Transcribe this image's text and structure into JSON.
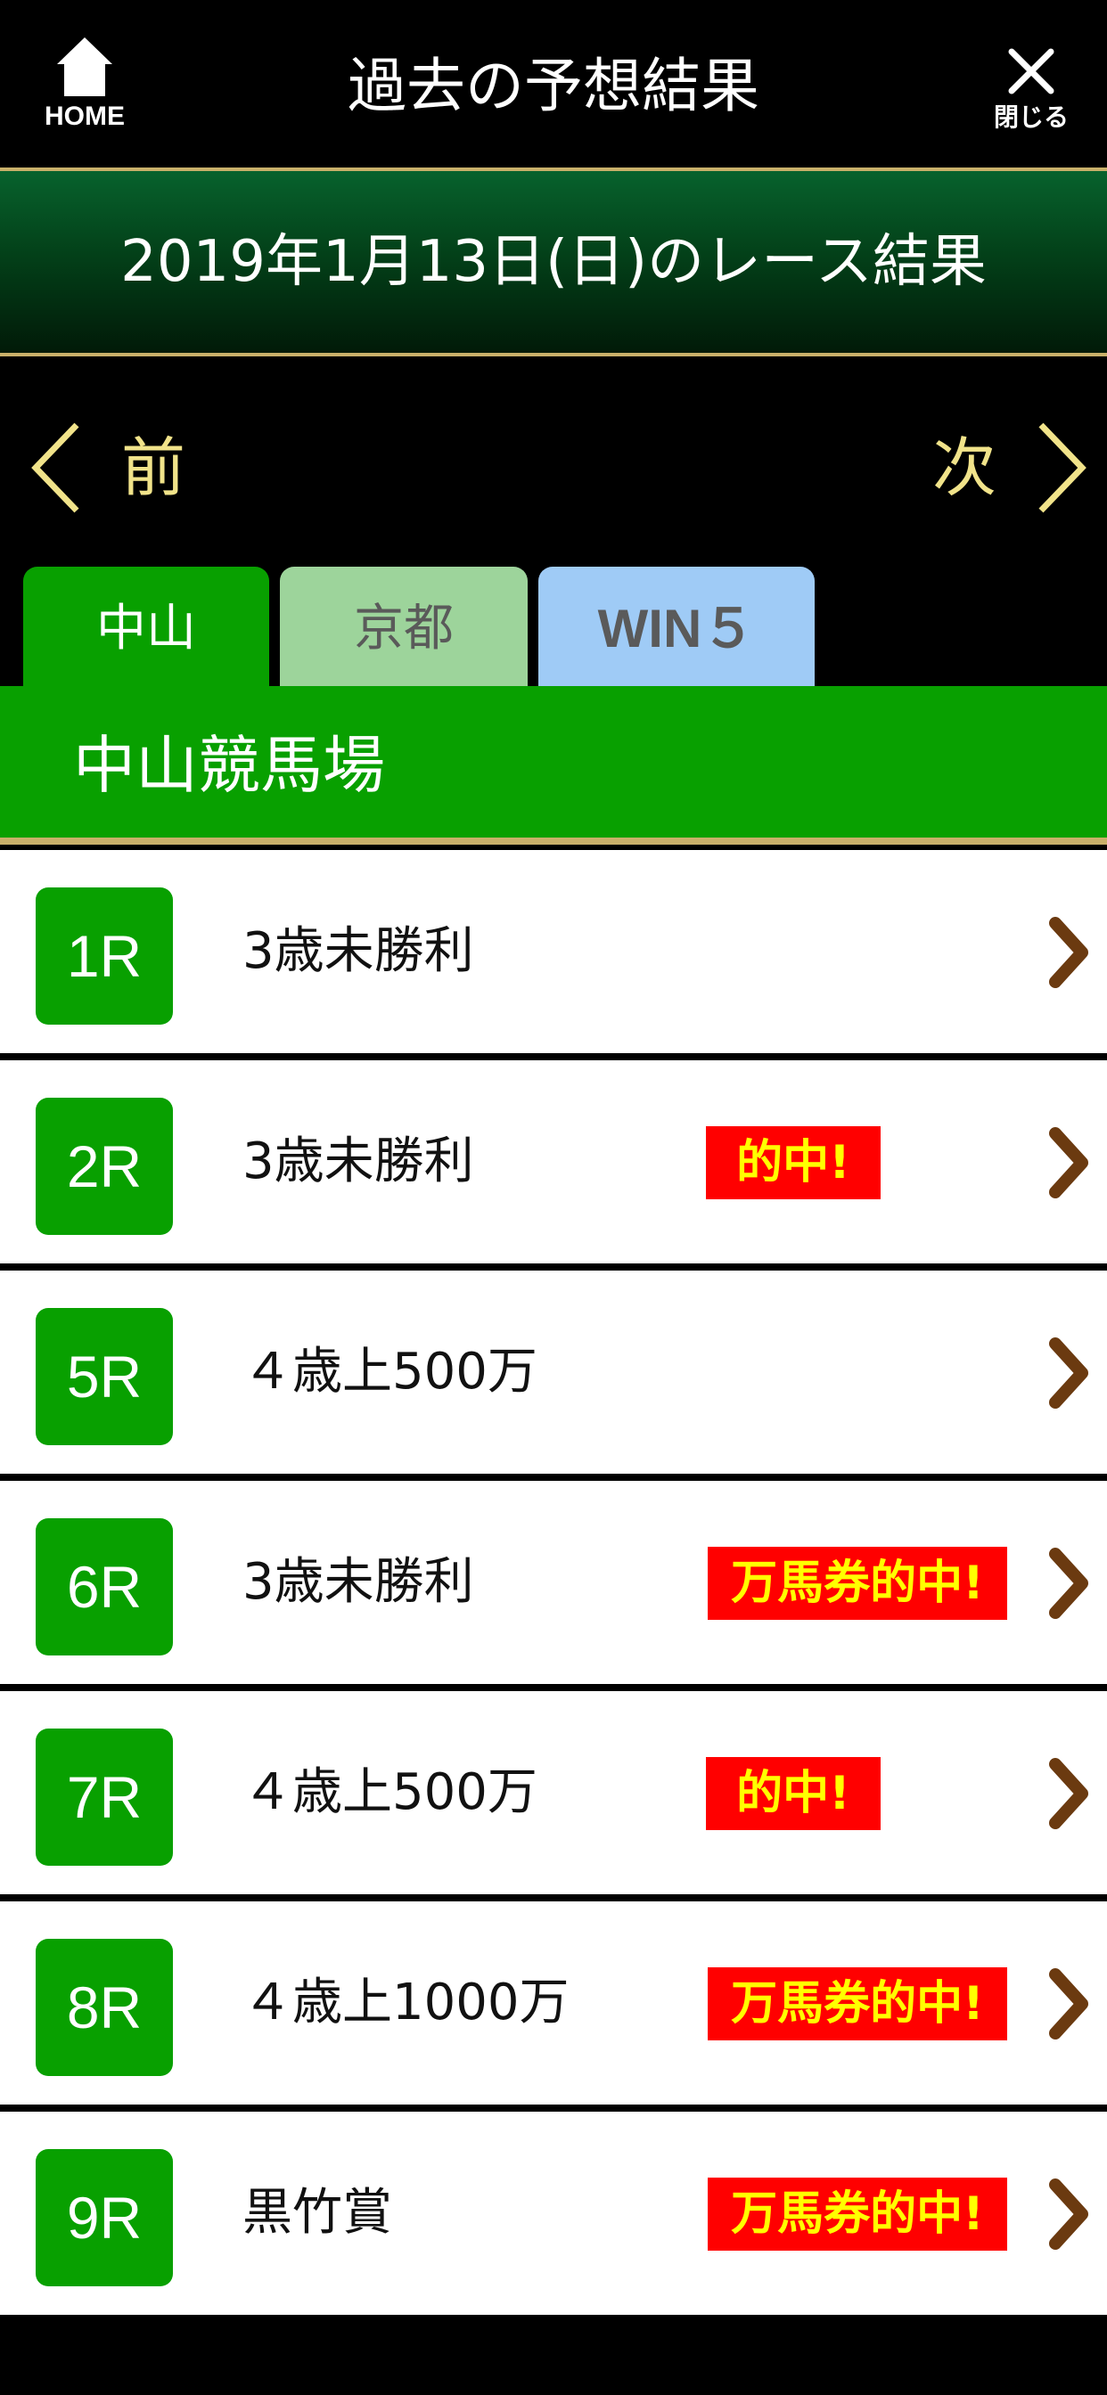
{
  "header": {
    "home_label": "HOME",
    "title": "過去の予想結果",
    "close_label": "閉じる"
  },
  "date_banner": {
    "text": "2019年1月13日(日)のレース結果"
  },
  "nav": {
    "prev_label": "前",
    "next_label": "次"
  },
  "tabs": [
    {
      "label": "中山",
      "active": true
    },
    {
      "label": "京都",
      "active": false
    },
    {
      "label": "WIN５",
      "active": false
    }
  ],
  "venue": {
    "name": "中山競馬場"
  },
  "races": [
    {
      "num": "1R",
      "name": "3歳未勝利",
      "badge": ""
    },
    {
      "num": "2R",
      "name": "3歳未勝利",
      "badge": "的中!"
    },
    {
      "num": "5R",
      "name": "４歳上500万",
      "badge": ""
    },
    {
      "num": "6R",
      "name": "3歳未勝利",
      "badge": "万馬券的中!"
    },
    {
      "num": "7R",
      "name": "４歳上500万",
      "badge": "的中!"
    },
    {
      "num": "8R",
      "name": "４歳上1000万",
      "badge": "万馬券的中!"
    },
    {
      "num": "9R",
      "name": "黒竹賞",
      "badge": "万馬券的中!"
    }
  ],
  "colors": {
    "accent_green": "#08a000",
    "gold_line": "#c9b06a",
    "nav_text": "#f1e38a",
    "badge_bg": "#ff0000",
    "badge_text": "#ffff00",
    "chevron": "#6b3a10",
    "tab_kyoto": "#9dd49b",
    "tab_win5": "#9fcbf6"
  },
  "icons": {
    "home": "home-icon",
    "close": "close-icon",
    "prev": "chevron-left-icon",
    "next": "chevron-right-icon",
    "row": "chevron-right-icon"
  }
}
